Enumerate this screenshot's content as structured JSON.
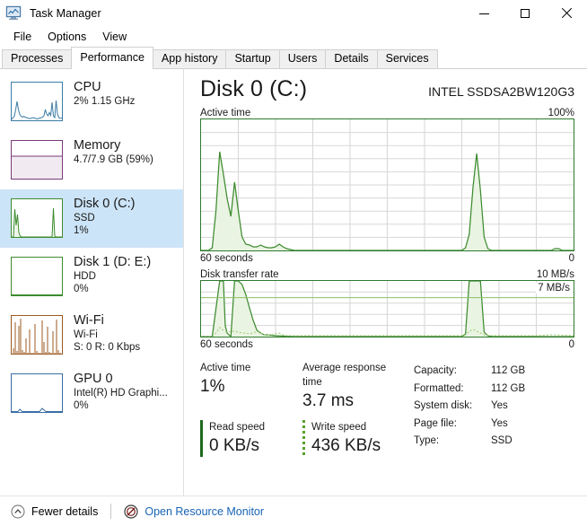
{
  "window": {
    "title": "Task Manager",
    "icon": "task-manager-icon",
    "controls": {
      "minimize": "minimize",
      "maximize": "maximize",
      "close": "close"
    }
  },
  "menu": {
    "items": [
      "File",
      "Options",
      "View"
    ]
  },
  "tabs": {
    "items": [
      "Processes",
      "Performance",
      "App history",
      "Startup",
      "Users",
      "Details",
      "Services"
    ],
    "active": "Performance"
  },
  "sidebar": {
    "items": [
      {
        "title": "CPU",
        "sub1": "2%  1.15 GHz",
        "sub2": "",
        "accent": "#3a7ca5",
        "fill": "#eaf3f9",
        "selected": false,
        "graph": "cpu"
      },
      {
        "title": "Memory",
        "sub1": "4.7/7.9 GB (59%)",
        "sub2": "",
        "accent": "#7a3a7a",
        "fill": "#f1ebf1",
        "selected": false,
        "graph": "memory"
      },
      {
        "title": "Disk 0 (C:)",
        "sub1": "SSD",
        "sub2": "1%",
        "accent": "#3d8b2f",
        "fill": "#eef6ea",
        "selected": true,
        "graph": "disk0"
      },
      {
        "title": "Disk 1 (D: E:)",
        "sub1": "HDD",
        "sub2": "0%",
        "accent": "#3d8b2f",
        "fill": "#eef6ea",
        "selected": false,
        "graph": "disk1"
      },
      {
        "title": "Wi-Fi",
        "sub1": "Wi-Fi",
        "sub2": "S: 0 R: 0 Kbps",
        "accent": "#9c5a21",
        "fill": "#fbf2e8",
        "selected": false,
        "graph": "wifi"
      },
      {
        "title": "GPU 0",
        "sub1": "Intel(R) HD Graphi...",
        "sub2": "0%",
        "accent": "#3a6ea5",
        "fill": "#eaeff7",
        "selected": false,
        "graph": "gpu"
      }
    ]
  },
  "main": {
    "title": "Disk 0 (C:)",
    "model": "INTEL SSDSA2BW120G3",
    "graph_top": {
      "label": "Active time",
      "max": "100%",
      "axis_left": "60 seconds",
      "axis_right": "0"
    },
    "graph_bottom": {
      "label": "Disk transfer rate",
      "max": "10 MB/s",
      "inline_tag": "7 MB/s",
      "axis_left": "60 seconds",
      "axis_right": "0"
    },
    "stats": [
      {
        "caption": "Active time",
        "value": "1%"
      },
      {
        "caption": "Average response time",
        "value": "3.7 ms"
      }
    ],
    "speeds": [
      {
        "caption": "Read speed",
        "value": "0 KB/s",
        "style": "solid"
      },
      {
        "caption": "Write speed",
        "value": "436 KB/s",
        "style": "dotted"
      }
    ],
    "properties": [
      {
        "key": "Capacity:",
        "value": "112 GB"
      },
      {
        "key": "Formatted:",
        "value": "112 GB"
      },
      {
        "key": "System disk:",
        "value": "Yes"
      },
      {
        "key": "Page file:",
        "value": "Yes"
      },
      {
        "key": "Type:",
        "value": "SSD"
      }
    ]
  },
  "statusbar": {
    "fewer_details": "Fewer details",
    "fewer_details_icon": "chevron-up-circle-icon",
    "resource_monitor": "Open Resource Monitor",
    "resource_monitor_icon": "resource-monitor-icon"
  },
  "chart_data": {
    "charts": [
      {
        "type": "area",
        "title": "Active time",
        "ylabel": "Active time",
        "xlabel": "60 seconds",
        "ylim": [
          0,
          100
        ],
        "yunit": "%",
        "grid": {
          "cols": 10,
          "rows": 10
        },
        "line_color": "#3d8b2f",
        "fill_color": "#eaf4e3",
        "x": [
          0,
          1,
          2,
          3,
          4,
          5,
          6,
          7,
          8,
          9,
          10,
          11,
          12,
          13,
          14,
          15,
          16,
          17,
          18,
          19,
          20,
          21,
          22,
          23,
          24,
          25,
          26,
          27,
          28,
          29,
          30,
          31,
          32,
          33,
          34,
          35,
          36,
          37,
          38,
          39,
          40,
          41,
          42,
          43,
          44,
          45,
          46,
          47,
          48,
          49,
          50,
          51,
          52,
          53,
          54,
          55,
          56,
          57,
          58,
          59,
          60,
          61,
          62,
          63,
          64,
          65,
          66,
          67,
          68,
          69,
          70,
          71,
          72,
          73,
          74,
          75,
          76,
          77,
          78,
          79,
          80,
          81,
          82,
          83,
          84,
          85,
          86,
          87,
          88,
          89,
          90,
          91,
          92,
          93,
          94,
          95,
          96,
          97,
          98,
          99,
          100
        ],
        "values": [
          0,
          0,
          0,
          2,
          30,
          75,
          58,
          40,
          26,
          52,
          30,
          10,
          5,
          4,
          3,
          3,
          4,
          3,
          2,
          2,
          3,
          5,
          3,
          1,
          1,
          0,
          0,
          0,
          0,
          0,
          0,
          0,
          0,
          0,
          0,
          0,
          0,
          0,
          0,
          0,
          0,
          0,
          0,
          0,
          0,
          0,
          0,
          0,
          0,
          0,
          0,
          0,
          0,
          0,
          0,
          0,
          0,
          0,
          0,
          0,
          0,
          0,
          0,
          0,
          0,
          0,
          0,
          0,
          0,
          0,
          0,
          1,
          12,
          48,
          74,
          46,
          10,
          1,
          0,
          0,
          0,
          0,
          0,
          0,
          0,
          0,
          0,
          0,
          0,
          0,
          0,
          0,
          0,
          0,
          1,
          1,
          0,
          0,
          0,
          0,
          0
        ]
      },
      {
        "type": "area",
        "title": "Disk transfer rate",
        "ylabel": "Disk transfer rate",
        "xlabel": "60 seconds",
        "ylim": [
          0,
          10
        ],
        "yunit": "MB/s",
        "reference_line": {
          "value": 7,
          "label": "7 MB/s"
        },
        "grid": {
          "cols": 10,
          "rows": 5
        },
        "line_color": "#3d8b2f",
        "fill_color": "#eaf4e3",
        "x": [
          0,
          1,
          2,
          3,
          4,
          5,
          6,
          7,
          8,
          9,
          10,
          11,
          12,
          13,
          14,
          15,
          16,
          17,
          18,
          19,
          20,
          21,
          22,
          23,
          24,
          25,
          26,
          27,
          28,
          29,
          30,
          31,
          32,
          33,
          34,
          35,
          36,
          37,
          38,
          39,
          40,
          41,
          42,
          43,
          44,
          45,
          46,
          47,
          48,
          49,
          50,
          51,
          52,
          53,
          54,
          55,
          56,
          57,
          58,
          59,
          60,
          61,
          62,
          63,
          64,
          65,
          66,
          67,
          68,
          69,
          70,
          71,
          72,
          73,
          74,
          75,
          76,
          77,
          78,
          79,
          80,
          81,
          82,
          83,
          84,
          85,
          86,
          87,
          88,
          89,
          90,
          91,
          92,
          93,
          94,
          95,
          96,
          97,
          98,
          99,
          100
        ],
        "series": [
          {
            "name": "Read",
            "values": [
              0,
              0,
              0,
              0.2,
              5,
              10,
              10,
              2,
              0.6,
              10,
              10,
              9.4,
              7.6,
              5.2,
              3,
              1.4,
              0.6,
              0.4,
              0.3,
              0.3,
              0.3,
              0.3,
              0.2,
              0.2,
              0.1,
              0.1,
              0.1,
              0.1,
              0,
              0,
              0,
              0,
              0,
              0,
              0,
              0,
              0,
              0,
              0,
              0,
              0,
              0,
              0,
              0,
              0,
              0,
              0,
              0,
              0,
              0,
              0,
              0,
              0,
              0,
              0,
              0,
              0,
              0,
              0,
              0,
              0,
              0,
              0,
              0,
              0,
              0,
              0,
              0,
              0,
              0,
              0,
              0,
              0.4,
              10,
              10,
              10,
              10,
              0.8,
              0.2,
              0.1,
              0.1,
              0,
              0,
              0,
              0,
              0,
              0,
              0,
              0,
              0,
              0,
              0,
              0,
              0,
              0,
              0.2,
              0.2,
              0,
              0,
              0,
              0,
              0
            ]
          },
          {
            "name": "Write",
            "values": [
              0,
              0,
              0,
              0,
              0.3,
              1.6,
              1.2,
              0.8,
              0.5,
              1,
              0.9,
              0.7,
              0.6,
              0.5,
              0.6,
              0.9,
              0.6,
              0.3,
              0.2,
              0.2,
              0.3,
              0.9,
              0.6,
              0.2,
              0.1,
              0.1,
              0.1,
              0.1,
              0.1,
              0.1,
              0.1,
              0.1,
              0.1,
              0.1,
              0.1,
              0.1,
              0.1,
              0.1,
              0.1,
              0.1,
              0.1,
              0.1,
              0.1,
              0.1,
              0.1,
              0.1,
              0.1,
              0.1,
              0.1,
              0.1,
              0.1,
              0.1,
              0.1,
              0.1,
              0.1,
              0.1,
              0.1,
              0.2,
              0.1,
              0.1,
              0.1,
              0.1,
              0.1,
              0.2,
              0.1,
              0.1,
              0.1,
              0.1,
              0.1,
              0.1,
              0.1,
              0.2,
              0.9,
              1.2,
              1,
              0.8,
              0.4,
              0.2,
              0.2,
              0.1,
              0.1,
              0.1,
              0.1,
              0.1,
              0.1,
              0.1,
              0.1,
              0.2,
              0.1,
              0.1,
              0.1,
              0.1,
              0.1,
              0.1,
              0.2,
              0.2,
              0.1,
              0.1,
              0.1,
              0.1,
              0.1
            ]
          }
        ]
      },
      {
        "type": "line",
        "title": "CPU thumbnail",
        "ylim": [
          0,
          100
        ],
        "line_color": "#3a7ca5",
        "values": [
          4,
          6,
          30,
          52,
          28,
          12,
          8,
          6,
          10,
          8,
          6,
          5,
          5,
          4,
          4,
          5,
          6,
          5,
          4,
          4,
          3,
          4,
          5,
          6,
          10,
          30,
          16,
          12,
          22,
          14,
          46,
          10,
          6,
          50,
          18,
          6,
          4,
          4,
          5,
          6
        ]
      },
      {
        "type": "line",
        "title": "Memory thumbnail",
        "ylim": [
          0,
          100
        ],
        "line_color": "#7a3a7a",
        "values": [
          59,
          59,
          59,
          59,
          59,
          59,
          59,
          59,
          59,
          59,
          59,
          59,
          59,
          59,
          59,
          59,
          59,
          59,
          59,
          59,
          59,
          59,
          59,
          59,
          59,
          59,
          59,
          59,
          59,
          59,
          59,
          59,
          59,
          59,
          59,
          59,
          59,
          59,
          59,
          59
        ]
      },
      {
        "type": "line",
        "title": "Disk 0 thumbnail",
        "ylim": [
          0,
          100
        ],
        "line_color": "#3d8b2f",
        "values": [
          0,
          0,
          70,
          30,
          60,
          12,
          4,
          2,
          1,
          1,
          1,
          1,
          1,
          1,
          1,
          1,
          1,
          1,
          1,
          1,
          1,
          1,
          1,
          1,
          1,
          1,
          1,
          1,
          1,
          1,
          1,
          1,
          1,
          1,
          76,
          4,
          1,
          1,
          1,
          1
        ]
      },
      {
        "type": "line",
        "title": "Disk 1 thumbnail",
        "ylim": [
          0,
          100
        ],
        "line_color": "#3d8b2f",
        "values": [
          0,
          0,
          0,
          0,
          0,
          0,
          0,
          0,
          0,
          0,
          0,
          0,
          0,
          0,
          0,
          0,
          0,
          0,
          0,
          0,
          0,
          0,
          0,
          0,
          0,
          0,
          0,
          0,
          0,
          0,
          0,
          0,
          0,
          0,
          0,
          0,
          0,
          0,
          0,
          0
        ]
      },
      {
        "type": "line",
        "title": "Wi-Fi thumbnail",
        "ylim": [
          0,
          100
        ],
        "line_color": "#9c5a21",
        "values": [
          10,
          80,
          4,
          70,
          90,
          6,
          4,
          20,
          2,
          60,
          2,
          2,
          75,
          4,
          2,
          2,
          85,
          30,
          4,
          2,
          70,
          4,
          2,
          2,
          60,
          2,
          2,
          80,
          4,
          2,
          88,
          6,
          2,
          2,
          70,
          4,
          2,
          55,
          2,
          2
        ]
      },
      {
        "type": "line",
        "title": "GPU 0 thumbnail",
        "ylim": [
          0,
          100
        ],
        "line_color": "#3a6ea5",
        "values": [
          0,
          0,
          0,
          2,
          2,
          0,
          0,
          0,
          0,
          0,
          0,
          0,
          0,
          0,
          0,
          0,
          0,
          0,
          0,
          0,
          0,
          0,
          0,
          0,
          2,
          4,
          2,
          0,
          0,
          0,
          0,
          0,
          0,
          0,
          0,
          0,
          0,
          0,
          0,
          0
        ]
      }
    ]
  }
}
